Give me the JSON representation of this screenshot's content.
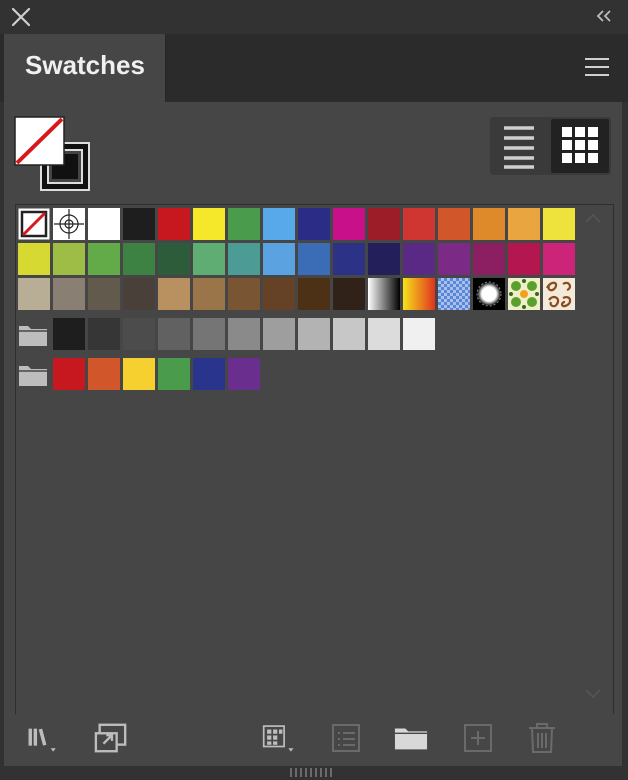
{
  "panel": {
    "tab_label": "Swatches"
  },
  "icons": {
    "close": "close-icon",
    "collapse": "double-chevron-left-icon",
    "menu": "hamburger-menu-icon",
    "list_view": "list-view-icon",
    "grid_view": "grid-view-icon",
    "folder": "folder-icon",
    "libraries": "libraries-icon",
    "place": "place-swatches-icon",
    "swatch_kind": "swatch-kind-menu-icon",
    "swatch_options": "swatch-options-icon",
    "new_group": "new-color-group-icon",
    "new_swatch": "new-swatch-icon",
    "delete": "trash-icon"
  },
  "colors": {
    "panel_bg": "#464646",
    "chrome_bg": "#323232",
    "none_slash": "#d7191c"
  },
  "swatch_rows": [
    [
      "none",
      "registration",
      "#ffffff",
      "#1e1e1e",
      "#c8181f",
      "#f5e82a",
      "#4a9b4b",
      "#57a9e9",
      "#2a2c86",
      "#c8108a",
      "#9c1c27",
      "#cf3531",
      "#d1572a",
      "#df8a2a",
      "#e8a540",
      "#eee33d"
    ],
    [
      "#d5d932",
      "#9dbd47",
      "#63ab48",
      "#3e8243",
      "#2d5c3a",
      "#5fad72",
      "#4c9c95",
      "#5ba3e0",
      "#3a6db5",
      "#2c3286",
      "#221f5a",
      "#5a2985",
      "#7b2a86",
      "#8b1f62",
      "#b4174f",
      "#cc2478"
    ],
    [
      "#b8ae95",
      "#8a7f73",
      "#625a4d",
      "#4a403a",
      "#b9905f",
      "#9b754a",
      "#7a5534",
      "#654225",
      "#4c3116",
      "#302219",
      "gradient-bw",
      "gradient-orange",
      "pattern-checker",
      "gradient-radial",
      "pattern-leaf",
      "pattern-swirl"
    ]
  ],
  "groups": [
    {
      "colors": [
        "#1e1e1e",
        "#363636",
        "#4c4c4c",
        "#616161",
        "#757575",
        "#8a8a8a",
        "#9e9e9e",
        "#b3b3b3",
        "#c7c7c7",
        "#dcdcdc",
        "#f0f0f0"
      ]
    },
    {
      "colors": [
        "#c8181f",
        "#d1572a",
        "#f6d02e",
        "#4a9b4b",
        "#29348c",
        "#6a2f8e"
      ]
    }
  ]
}
